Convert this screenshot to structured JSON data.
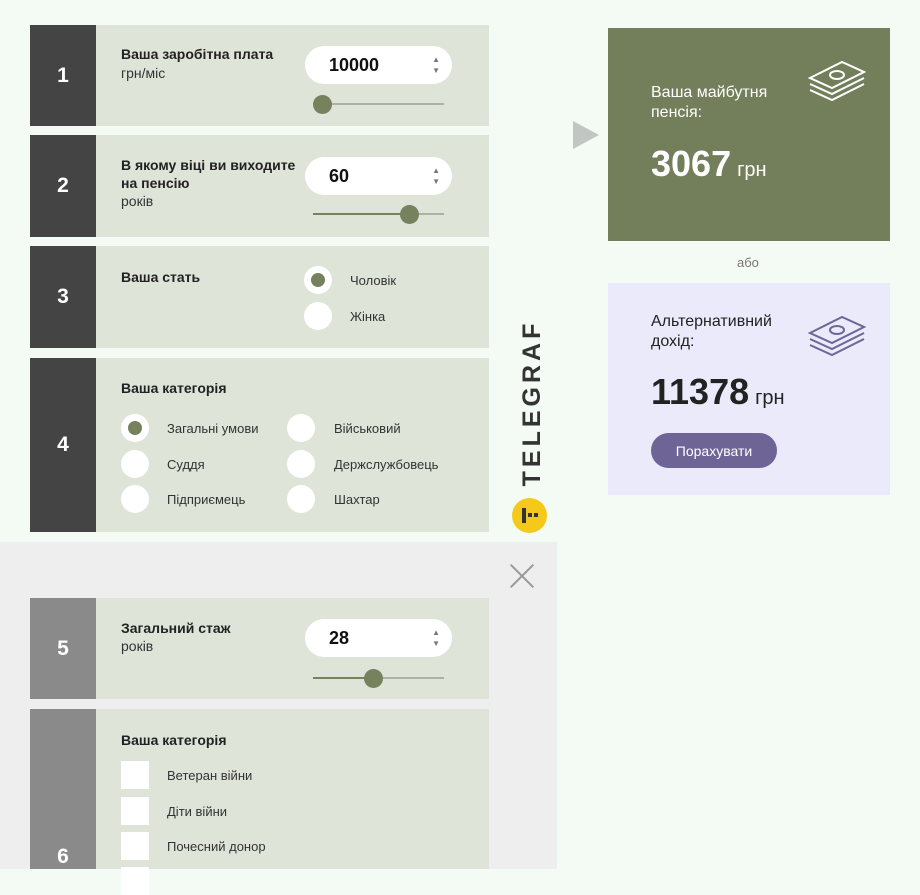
{
  "steps": {
    "s1": {
      "num": "1",
      "title": "Ваша заробітна плата",
      "sub": "грн/міс",
      "value": "10000",
      "slider_fraction": 0.07
    },
    "s2": {
      "num": "2",
      "title": "В якому віці ви виходите на пенсію",
      "sub": "років",
      "value": "60",
      "slider_fraction": 0.73
    },
    "s3": {
      "num": "3",
      "title": "Ваша стать",
      "options": [
        "Чоловік",
        "Жінка"
      ],
      "selected": "Чоловік"
    },
    "s4": {
      "num": "4",
      "title": "Ваша категорія",
      "options": [
        "Загальні умови",
        "Суддя",
        "Підприємець",
        "Військовий",
        "Держслужбовець",
        "Шахтар"
      ],
      "selected": "Загальні умови"
    },
    "s5": {
      "num": "5",
      "title": "Загальний стаж",
      "sub": "років",
      "value": "28",
      "slider_fraction": 0.46
    },
    "s6": {
      "num": "6",
      "title": "Ваша категорія",
      "options": [
        "Ветеран війни",
        "Діти війни",
        "Почесний донор"
      ]
    }
  },
  "arrows": {
    "up": "▲",
    "down": "▼"
  },
  "result_pension": {
    "label": "Ваша майбутня пенсія:",
    "amount": "3067",
    "unit": "грн",
    "icon": "money-stack-icon",
    "bg": "#737f5b"
  },
  "or_text": "або",
  "result_alt": {
    "label": "Альтернативний дохід:",
    "amount": "11378",
    "unit": "грн",
    "icon": "money-stack-icon",
    "bg": "#eaeafa",
    "button": "Порахувати"
  },
  "brand": {
    "name": "TELEGRAF",
    "color": "#f4c91a"
  },
  "colors": {
    "accent": "#76825e",
    "button": "#6e6596",
    "dark_number": "#444444"
  }
}
